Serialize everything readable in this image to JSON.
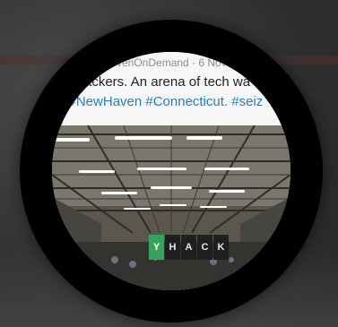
{
  "tweet": {
    "meta": "venOnDemand · 6 Nov",
    "text": "ackers. An arena of tech wa",
    "hashtags": "g #NewHaven #Connecticut. #seiz"
  },
  "banner": {
    "letters": [
      "Y",
      "H",
      "A",
      "C",
      "K"
    ]
  },
  "colors": {
    "lens": "#000000",
    "hashtag": "#2b7bb9",
    "banner_logo": "#37a25c"
  },
  "icons": {
    "banner_logo": "yhack-logo-icon"
  }
}
